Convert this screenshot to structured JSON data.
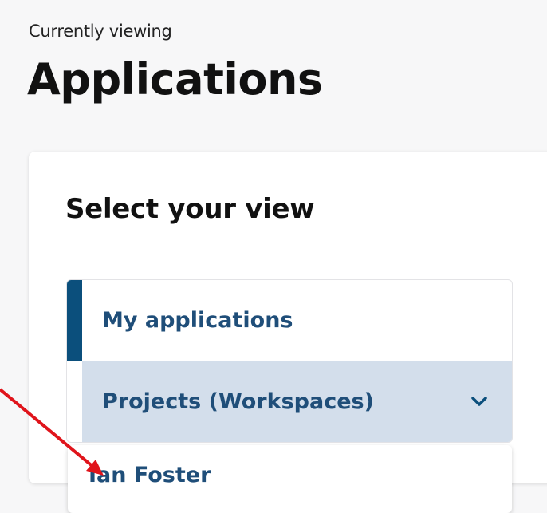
{
  "header": {
    "eyebrow": "Currently viewing",
    "title": "Applications"
  },
  "view_selector": {
    "title": "Select your view",
    "items": [
      {
        "label": "My applications",
        "active": true
      },
      {
        "label": "Projects (Workspaces)",
        "expanded": true
      }
    ],
    "dropdown": {
      "options": [
        "Ian Foster"
      ]
    }
  },
  "icons": {
    "expand": "chevron-down-icon",
    "annotation": "red-arrow-annotation"
  },
  "colors": {
    "accent": "#0b4f7c",
    "link_text": "#1f4e79",
    "expanded_bg": "#d3deeb",
    "annotation": "#e0141b"
  }
}
